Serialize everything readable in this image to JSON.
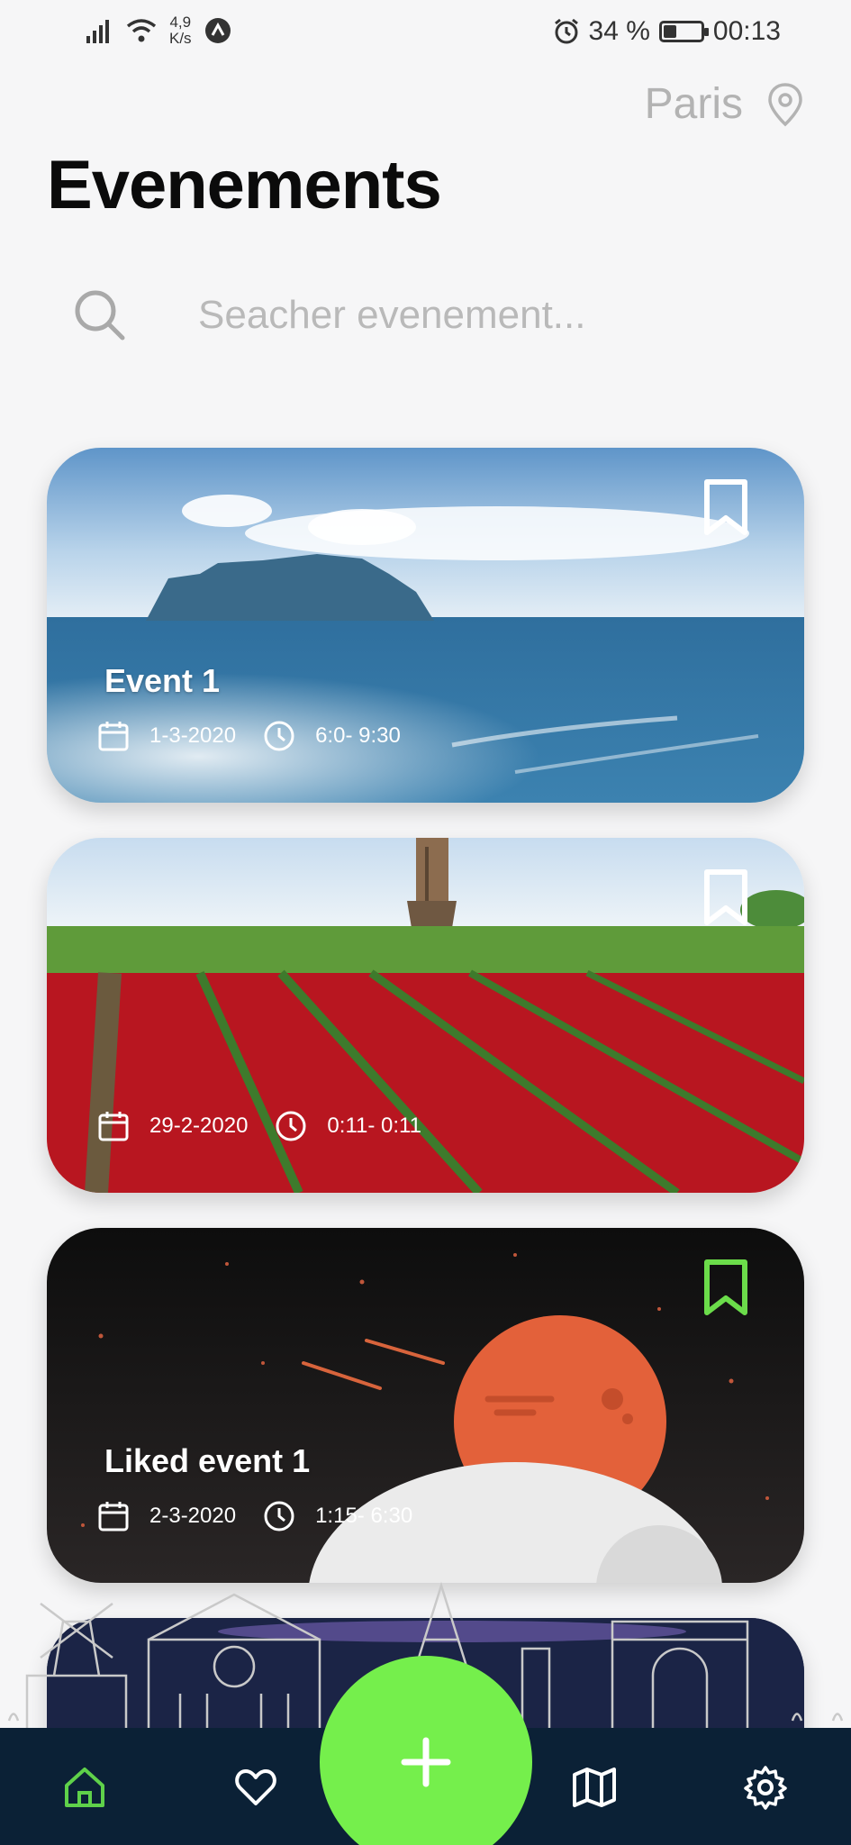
{
  "status_bar": {
    "network_speed_value": "4,9",
    "network_speed_unit": "K/s",
    "battery": "34 %",
    "battery_level": 0.34,
    "time": "00:13"
  },
  "header": {
    "location": "Paris",
    "title": "Evenements"
  },
  "search": {
    "placeholder": "Seacher evenement..."
  },
  "events": [
    {
      "title": "Event 1",
      "date": "1-3-2020",
      "time": "6:0- 9:30",
      "saved": false,
      "image": "island-seascape"
    },
    {
      "title": "",
      "date": "29-2-2020",
      "time": "0:11- 0:11",
      "saved": false,
      "image": "tulip-field-windmill"
    },
    {
      "title": "Liked event 1",
      "date": "2-3-2020",
      "time": "1:15- 6:30",
      "saved": true,
      "image": "space-planets"
    }
  ],
  "bottom_nav": {
    "items": [
      "home",
      "favorites",
      "add",
      "map",
      "settings"
    ],
    "active": "home"
  },
  "colors": {
    "accent_green": "#75ef4c",
    "nav_background": "#0b2136",
    "active_icon": "#5fd14a",
    "saved_bookmark": "#6bdc4a"
  }
}
